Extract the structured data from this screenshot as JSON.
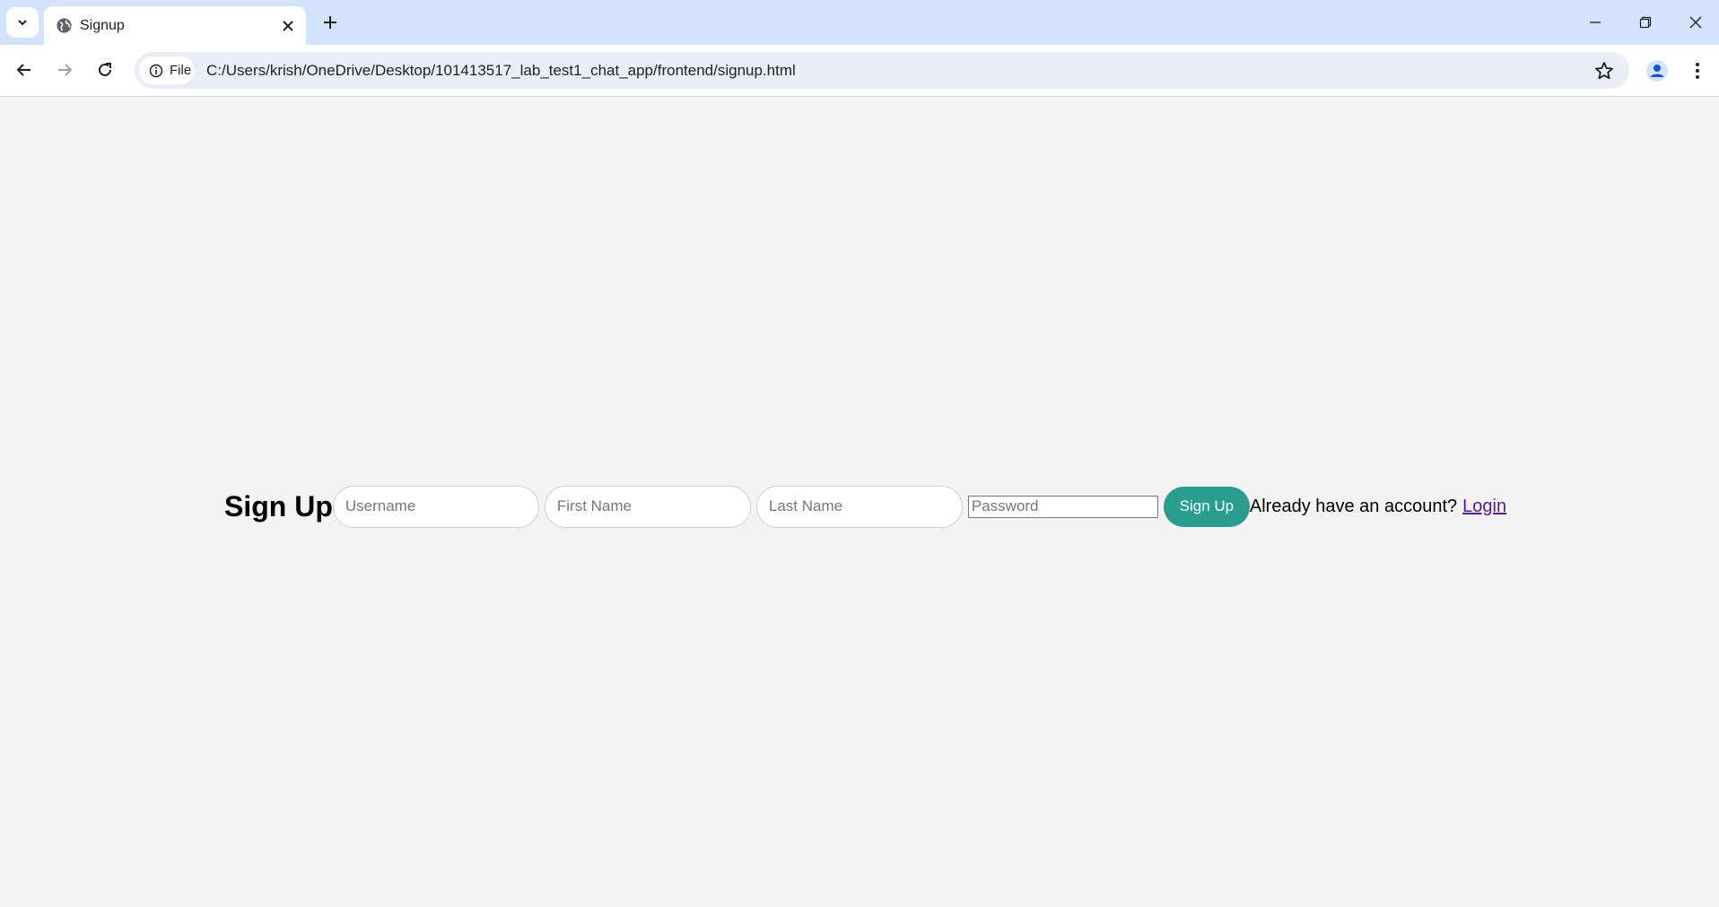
{
  "browser": {
    "tab_title": "Signup",
    "address_chip": "File",
    "url": "C:/Users/krish/OneDrive/Desktop/101413517_lab_test1_chat_app/frontend/signup.html",
    "icons": [
      "tab-search-icon",
      "globe-icon",
      "close-icon",
      "plus-icon",
      "minimize-icon",
      "restore-icon",
      "close-window-icon",
      "back-icon",
      "forward-icon",
      "reload-icon",
      "info-icon",
      "star-icon",
      "profile-icon",
      "more-vert-icon"
    ]
  },
  "page": {
    "heading": "Sign Up",
    "fields": {
      "username_placeholder": "Username",
      "first_name_placeholder": "First Name",
      "last_name_placeholder": "Last Name",
      "password_placeholder": "Password"
    },
    "submit_label": "Sign Up",
    "already_text": "Already have an account?",
    "login_link": "Login",
    "colors": {
      "background": "#f3f3f3",
      "button": "#2a9d8f",
      "link": "#551a8b"
    }
  }
}
